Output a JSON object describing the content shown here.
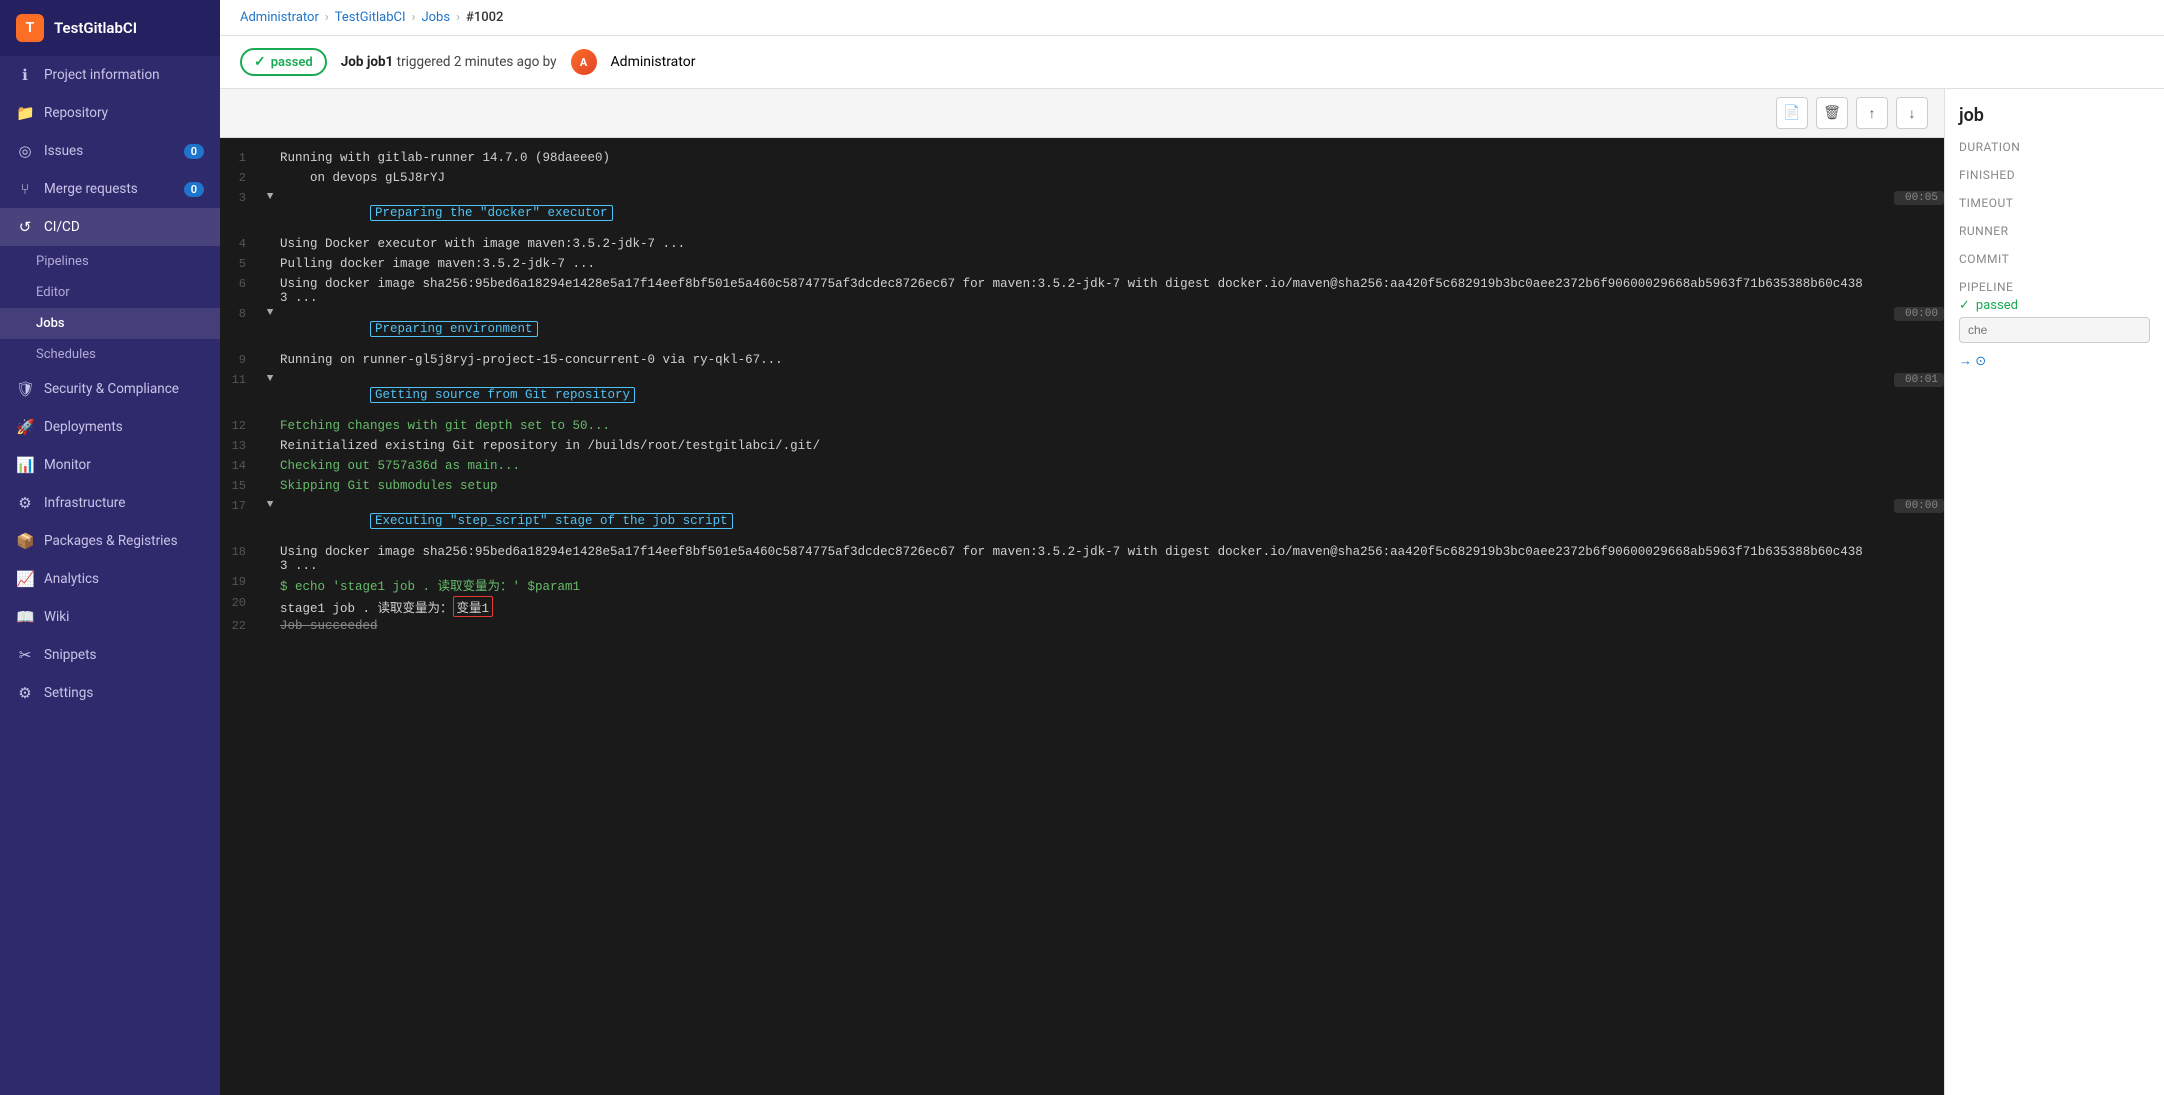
{
  "app": {
    "title": "TestGitlabCI",
    "logo_initial": "T"
  },
  "sidebar": {
    "project_name": "TestGitlabCI",
    "items": [
      {
        "id": "project-information",
        "label": "Project information",
        "icon": "ℹ",
        "badge": null,
        "active": false
      },
      {
        "id": "repository",
        "label": "Repository",
        "icon": "📁",
        "badge": null,
        "active": false
      },
      {
        "id": "issues",
        "label": "Issues",
        "icon": "⊙",
        "badge": "0",
        "active": false
      },
      {
        "id": "merge-requests",
        "label": "Merge requests",
        "icon": "⑂",
        "badge": "0",
        "active": false
      },
      {
        "id": "cicd",
        "label": "CI/CD",
        "icon": "⟳",
        "badge": null,
        "active": true
      },
      {
        "id": "security-compliance",
        "label": "Security & Compliance",
        "icon": "🛡",
        "badge": null,
        "active": false
      },
      {
        "id": "deployments",
        "label": "Deployments",
        "icon": "🚀",
        "badge": null,
        "active": false
      },
      {
        "id": "monitor",
        "label": "Monitor",
        "icon": "📊",
        "badge": null,
        "active": false
      },
      {
        "id": "infrastructure",
        "label": "Infrastructure",
        "icon": "⚙",
        "badge": null,
        "active": false
      },
      {
        "id": "packages-registries",
        "label": "Packages & Registries",
        "icon": "📦",
        "badge": null,
        "active": false
      },
      {
        "id": "analytics",
        "label": "Analytics",
        "icon": "📈",
        "badge": null,
        "active": false
      },
      {
        "id": "wiki",
        "label": "Wiki",
        "icon": "📖",
        "badge": null,
        "active": false
      },
      {
        "id": "snippets",
        "label": "Snippets",
        "icon": "✂",
        "badge": null,
        "active": false
      },
      {
        "id": "settings",
        "label": "Settings",
        "icon": "⚙",
        "badge": null,
        "active": false
      }
    ],
    "cicd_sub_items": [
      {
        "id": "pipelines",
        "label": "Pipelines",
        "active": false
      },
      {
        "id": "editor",
        "label": "Editor",
        "active": false
      },
      {
        "id": "jobs",
        "label": "Jobs",
        "active": true
      },
      {
        "id": "schedules",
        "label": "Schedules",
        "active": false
      }
    ]
  },
  "breadcrumb": {
    "items": [
      "Administrator",
      "TestGitlabCI",
      "Jobs",
      "#1002"
    ]
  },
  "job_header": {
    "status": "passed",
    "status_label": "passed",
    "description": "Job job1 triggered 2 minutes ago by",
    "user": "Administrator",
    "avatar_initial": "A"
  },
  "toolbar": {
    "raw_btn": "📄",
    "delete_btn": "🗑",
    "scroll_top_btn": "↑",
    "scroll_bottom_btn": "↓"
  },
  "terminal": {
    "lines": [
      {
        "num": 1,
        "content": "Running with gitlab-runner 14.7.0 (98daeee0)",
        "type": "normal",
        "time": null,
        "collapsible": false
      },
      {
        "num": 2,
        "content": "    on devops gL5J8rYJ",
        "type": "normal",
        "time": null,
        "collapsible": false
      },
      {
        "num": 3,
        "content": "Preparing the \"docker\" executor",
        "type": "section-header",
        "time": "00:05",
        "collapsible": true
      },
      {
        "num": 4,
        "content": "Using Docker executor with image maven:3.5.2-jdk-7 ...",
        "type": "normal",
        "time": null,
        "collapsible": false
      },
      {
        "num": 5,
        "content": "Pulling docker image maven:3.5.2-jdk-7 ...",
        "type": "normal",
        "time": null,
        "collapsible": false
      },
      {
        "num": 6,
        "content": "Using docker image sha256:95bed6a18294e1428e5a17f14eef8bf501e5a460c5874775af3dcdec8726ec67 for maven:3.5.2-jdk-7 with digest docker.io/maven@sha256:aa420f5c682919b3bc0aee2372b6f90600029668ab5963f71b635388b60c4383 ...",
        "type": "normal",
        "time": null,
        "collapsible": false
      },
      {
        "num": 8,
        "content": "Preparing environment",
        "type": "section-header",
        "time": "00:00",
        "collapsible": true
      },
      {
        "num": 9,
        "content": "Running on runner-gl5j8ryj-project-15-concurrent-0 via ry-qkl-67...",
        "type": "normal",
        "time": null,
        "collapsible": false
      },
      {
        "num": 11,
        "content": "Getting source from Git repository",
        "type": "section-header",
        "time": "00:01",
        "collapsible": true
      },
      {
        "num": 12,
        "content": "Fetching changes with git depth set to 50...",
        "type": "green",
        "time": null,
        "collapsible": false
      },
      {
        "num": 13,
        "content": "Reinitialized existing Git repository in /builds/root/testgitlabci/.git/",
        "type": "normal",
        "time": null,
        "collapsible": false
      },
      {
        "num": 14,
        "content": "Checking out 5757a36d as main...",
        "type": "green",
        "time": null,
        "collapsible": false
      },
      {
        "num": 15,
        "content": "Skipping Git submodules setup",
        "type": "green",
        "time": null,
        "collapsible": false
      },
      {
        "num": 17,
        "content": "Executing \"step_script\" stage of the job script",
        "type": "executing",
        "time": "00:00",
        "collapsible": true
      },
      {
        "num": 18,
        "content": "Using docker image sha256:95bed6a18294e1428e5a17f14eef8bf501e5a460c5874775af3dcdec8726ec67 for maven:3.5.2-jdk-7 with digest docker.io/maven@sha256:aa420f5c682919b3bc0aee2372b6f90600029668ab5963f71b635388b60c4383 ...",
        "type": "normal",
        "time": null,
        "collapsible": false
      },
      {
        "num": 19,
        "content": "$ echo 'stage1 job . 读取变量为：' $param1",
        "type": "cmd",
        "time": null,
        "collapsible": false
      },
      {
        "num": 20,
        "content": "stage1 job . 读取变量为：变量1",
        "type": "output-highlight",
        "time": null,
        "collapsible": false
      },
      {
        "num": 22,
        "content": "Job succeeded",
        "type": "strikethrough",
        "time": null,
        "collapsible": false
      }
    ]
  },
  "right_panel": {
    "title": "job",
    "duration_label": "Duration",
    "duration_value": "",
    "finished_label": "Finished",
    "finished_value": "",
    "timeout_label": "Timeout",
    "timeout_value": "",
    "runner_label": "Runner",
    "runner_value": "",
    "commit_label": "Commit",
    "commit_value": "",
    "pipeline_label": "Pipeline",
    "pipeline_status": "passed",
    "pipeline_id": "",
    "commit_placeholder": "che",
    "arrow_label": "→ ⊙"
  }
}
